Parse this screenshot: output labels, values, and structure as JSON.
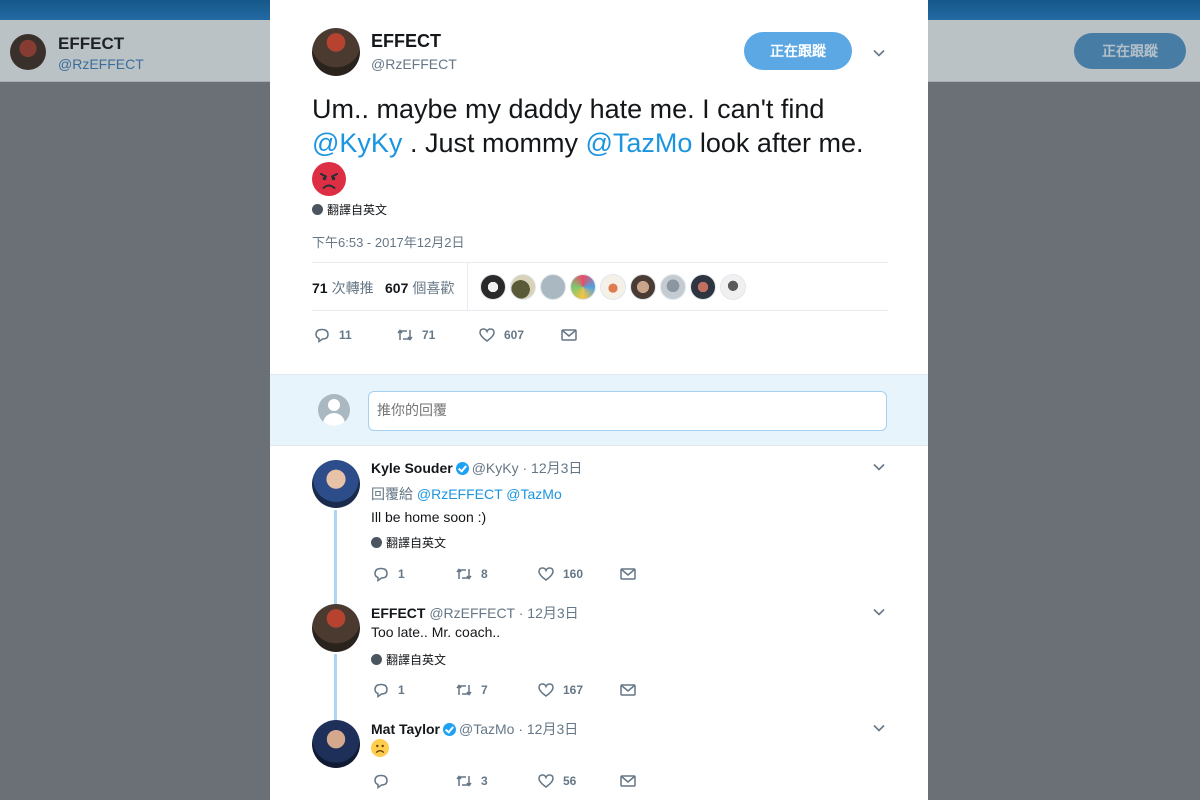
{
  "background": {
    "name": "EFFECT",
    "handle": "@RzEFFECT",
    "follow_label": "正在跟蹤"
  },
  "tweet": {
    "name": "EFFECT",
    "handle": "@RzEFFECT",
    "follow_label": "正在跟蹤",
    "text": {
      "part1": "Um.. maybe my daddy hate me. I can't find ",
      "mention1": "@KyKy",
      "part2": " . Just mommy ",
      "mention2": "@TazMo",
      "part3": " look after me."
    },
    "emoji": "angry-face",
    "translate": "翻譯自英文",
    "timestamp": "下午6:53 - 2017年12月2日",
    "retweets": {
      "count": "71",
      "label": "次轉推"
    },
    "likes": {
      "count": "607",
      "label": "個喜歡"
    },
    "actions": {
      "replies": "11",
      "retweets": "71",
      "likes": "607"
    }
  },
  "reply_box": {
    "placeholder": "推你的回覆"
  },
  "replies": [
    {
      "name": "Kyle Souder",
      "verified": true,
      "handle": "@KyKy",
      "date": "· 12月3日",
      "reply_to_label": "回覆給",
      "reply_to": "@RzEFFECT @TazMo",
      "text": "Ill be home soon :)",
      "translate": "翻譯自英文",
      "actions": {
        "replies": "1",
        "retweets": "8",
        "likes": "160"
      }
    },
    {
      "name": "EFFECT",
      "verified": false,
      "handle": "@RzEFFECT",
      "date": "· 12月3日",
      "text": "Too late.. Mr. coach..",
      "translate": "翻譯自英文",
      "actions": {
        "replies": "1",
        "retweets": "7",
        "likes": "167"
      }
    },
    {
      "name": "Mat Taylor",
      "verified": true,
      "handle": "@TazMo",
      "date": "· 12月3日",
      "emoji": "frowning-face",
      "actions": {
        "replies": "",
        "retweets": "3",
        "likes": "56"
      }
    }
  ],
  "colors": {
    "accent": "#1b95e0",
    "follow_button": "#5ba8e4",
    "reply_bg": "#e8f4fc"
  }
}
